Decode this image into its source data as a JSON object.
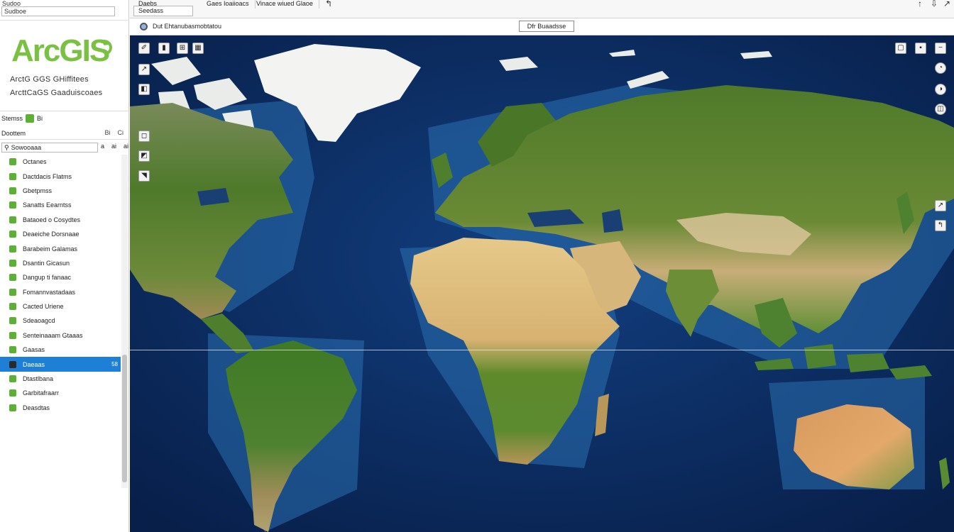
{
  "left_panel": {
    "top_label": "Sudoo",
    "search_value": "Sudboe",
    "logo_text": "ArcGIS",
    "subtitle_1": "ArctG GGS GHiffitees",
    "subtitle_2": "ArcttCaGS Gaaduiscoaes",
    "layers_header": "Stemss",
    "layers_header_suffix": "Bi",
    "contents_label": "Doottem",
    "contents_ctl_1": "Bi",
    "contents_ctl_2": "Ci",
    "filter_value": "Sowooaaa",
    "filter_ctl_1": "a",
    "filter_ctl_2": "ai",
    "filter_ctl_3": "ai",
    "layers": [
      {
        "label": "Octanes"
      },
      {
        "label": "Dactdacis Flatms"
      },
      {
        "label": "Gbetpmss"
      },
      {
        "label": "Sanatts Eearntss"
      },
      {
        "label": "Bataoed o Cosydtes"
      },
      {
        "label": "Deaeiche Dorsnaae"
      },
      {
        "label": "Barabeim Galamas"
      },
      {
        "label": "Dsantin Gicasun"
      },
      {
        "label": "Dangup ti fanaac"
      },
      {
        "label": "Fomannvastadaas"
      },
      {
        "label": "Cacted Uriene"
      },
      {
        "label": "Sdeaoagcd"
      },
      {
        "label": "Senteinaaam Gtaaas"
      },
      {
        "label": "Gaasas"
      },
      {
        "label": "Daeaas",
        "count": "58",
        "selected": true
      },
      {
        "label": "Dtastlbana"
      },
      {
        "label": "Garbitafraarr"
      },
      {
        "label": "Deasdtas"
      }
    ]
  },
  "toolbar": {
    "label_top": "Daebs",
    "box_value": "Seedass",
    "tab_1": "Gaes Ioaiioacs",
    "tab_2": "Vinace wiued Glaoe",
    "icon_back": "↰",
    "icon_up": "↑",
    "icon_down": "⇩",
    "icon_expand": "↗"
  },
  "subbar": {
    "title": "Dut Ehtanubasmobtatou",
    "box_label": "Dfr Buaadsse"
  },
  "map": {
    "tools_left": [
      "✐",
      "▮",
      "⊞",
      "▦"
    ],
    "tools_left_2": [
      "↗",
      "◧",
      "◻",
      "◩",
      "◥"
    ],
    "tools_right": [
      "▢",
      "▪",
      "−"
    ],
    "tools_right_2": [
      "◔",
      "◑",
      "◫"
    ],
    "tools_right_3": [
      "↗",
      "↰"
    ]
  },
  "colors": {
    "accent_green": "#7ac143",
    "selection_blue": "#1e7fd6",
    "ocean_deep": "#0b2f66",
    "ocean_shelf": "#2a6fb0"
  },
  "icons": [
    "search-icon",
    "layer-icon",
    "globe-icon",
    "zoom-in-icon",
    "zoom-out-icon",
    "measure-icon"
  ]
}
